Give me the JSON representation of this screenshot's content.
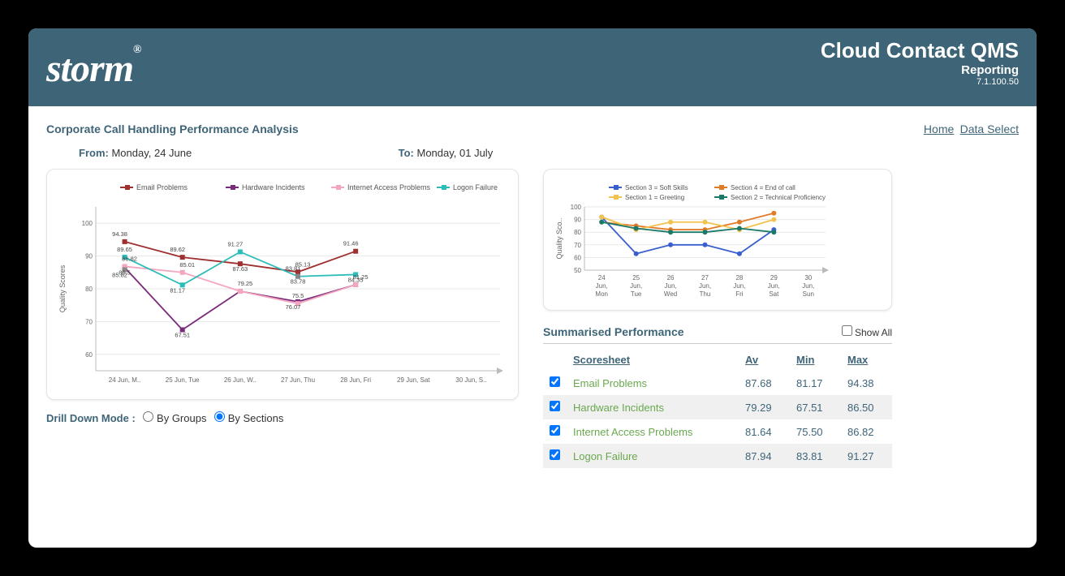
{
  "header": {
    "app": "Cloud Contact QMS",
    "sub": "Reporting",
    "version": "7.1.100.50",
    "logo": "storm"
  },
  "nav": {
    "home": "Home",
    "data_select": "Data Select"
  },
  "page_title": "Corporate Call Handling Performance Analysis",
  "date_range": {
    "from_label": "From:",
    "from": "Monday, 24 June",
    "to_label": "To:",
    "to": "Monday, 01 July"
  },
  "drill": {
    "label": "Drill Down Mode :",
    "by_groups": "By Groups",
    "by_sections": "By Sections"
  },
  "summary": {
    "title": "Summarised Performance",
    "show_all": "Show All",
    "columns": {
      "scoresheet": "Scoresheet",
      "av": "Av",
      "min": "Min",
      "max": "Max"
    },
    "rows": [
      {
        "name": "Email Problems",
        "av": "87.68",
        "min": "81.17",
        "max": "94.38",
        "checked": true
      },
      {
        "name": "Hardware Incidents",
        "av": "79.29",
        "min": "67.51",
        "max": "86.50",
        "checked": true
      },
      {
        "name": "Internet Access Problems",
        "av": "81.64",
        "min": "75.50",
        "max": "86.82",
        "checked": true
      },
      {
        "name": "Logon Failure",
        "av": "87.94",
        "min": "83.81",
        "max": "91.27",
        "checked": true
      }
    ]
  },
  "chart_data": [
    {
      "type": "line",
      "title": "",
      "ylabel": "Quality Scores",
      "ylim": [
        55,
        105
      ],
      "categories": [
        "24 Jun, M..",
        "25 Jun, Tue",
        "26 Jun, W..",
        "27 Jun, Thu",
        "28 Jun, Fri",
        "29 Jun, Sat",
        "30 Jun, S.."
      ],
      "series": [
        {
          "name": "Email Problems",
          "color": "#a03030",
          "values": [
            94.38,
            89.62,
            87.63,
            85.13,
            91.46,
            null,
            null
          ]
        },
        {
          "name": "Hardware Incidents",
          "color": "#7a2a7a",
          "values": [
            86.5,
            67.51,
            79.25,
            76.07,
            81.25,
            null,
            null
          ]
        },
        {
          "name": "Internet Access Problems",
          "color": "#f4a6c0",
          "values": [
            86.82,
            85.01,
            79.25,
            75.5,
            81.25,
            null,
            null
          ]
        },
        {
          "name": "Logon Failure",
          "color": "#2bbdb8",
          "values": [
            89.65,
            81.17,
            91.27,
            83.78,
            84.35,
            null,
            null
          ]
        },
        {
          "name": "_overlay1",
          "color": "#888",
          "values": [
            85.82,
            null,
            null,
            83.81,
            null,
            null,
            null
          ]
        }
      ],
      "data_labels": {
        "0": [
          "94.38",
          "86.5",
          "86.82",
          "85.82",
          "89.65"
        ],
        "1": [
          "89.62",
          "67.51",
          "85.01",
          "81.17"
        ],
        "2": [
          "91.27",
          "87.63",
          "79.25"
        ],
        "3": [
          "83.81",
          "83.78",
          "85.13",
          "76.07",
          "75.5"
        ],
        "4": [
          "91.46",
          "84.35",
          "81.25"
        ]
      }
    },
    {
      "type": "line",
      "title": "",
      "ylabel": "Quality Sco..",
      "ylim": [
        50,
        100
      ],
      "categories": [
        "24 Jun, Mon",
        "25 Jun, Tue",
        "26 Jun, Wed",
        "27 Jun, Thu",
        "28 Jun, Fri",
        "29 Jun, Sat",
        "30 Jun, Sun"
      ],
      "series": [
        {
          "name": "Section 3 = Soft Skills",
          "color": "#3a5fcd",
          "values": [
            92,
            63,
            70,
            70,
            63,
            82,
            null
          ]
        },
        {
          "name": "Section 4 = End of call",
          "color": "#e07b2a",
          "values": [
            88,
            85,
            82,
            82,
            88,
            95,
            null
          ]
        },
        {
          "name": "Section 1 = Greeting",
          "color": "#f2c14e",
          "values": [
            92,
            82,
            88,
            88,
            82,
            90,
            null
          ]
        },
        {
          "name": "Section 2 = Technical Proficiency",
          "color": "#1a7a6a",
          "values": [
            88,
            83,
            80,
            80,
            83,
            80,
            null
          ]
        }
      ]
    }
  ]
}
